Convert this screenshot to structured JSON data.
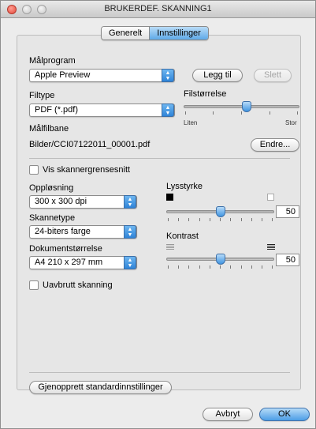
{
  "window": {
    "title": "BRUKERDEF. SKANNING1"
  },
  "tabs": [
    {
      "label": "Generelt",
      "active": false
    },
    {
      "label": "Innstillinger",
      "active": true
    }
  ],
  "target_app": {
    "label": "Målprogram",
    "value": "Apple Preview",
    "add_button": "Legg til",
    "delete_button": "Slett"
  },
  "file_type": {
    "label": "Filtype",
    "value": "PDF (*.pdf)"
  },
  "file_size": {
    "label": "Filstørrelse",
    "min_label": "Liten",
    "max_label": "Stor",
    "level": 0.55
  },
  "destination": {
    "label": "Målfilbane",
    "path": "Bilder/CCI07122011_00001.pdf",
    "change_button": "Endre..."
  },
  "show_scanner_interface": {
    "label": "Vis skannergrensesnitt",
    "checked": false
  },
  "resolution": {
    "label": "Oppløsning",
    "value": "300 x 300 dpi"
  },
  "scan_type": {
    "label": "Skannetype",
    "value": "24-biters farge"
  },
  "document_size": {
    "label": "Dokumentstørrelse",
    "value": "A4 210 x 297 mm"
  },
  "continuous_scan": {
    "label": "Uavbrutt skanning",
    "checked": false
  },
  "brightness": {
    "label": "Lysstyrke",
    "value": "50",
    "level": 0.5
  },
  "contrast": {
    "label": "Kontrast",
    "value": "50",
    "level": 0.5
  },
  "footer": {
    "restore_defaults": "Gjenopprett standardinnstillinger",
    "cancel": "Avbryt",
    "ok": "OK"
  },
  "colors": {
    "accent": "#4c9ee6",
    "close_button": "#e4483a"
  }
}
